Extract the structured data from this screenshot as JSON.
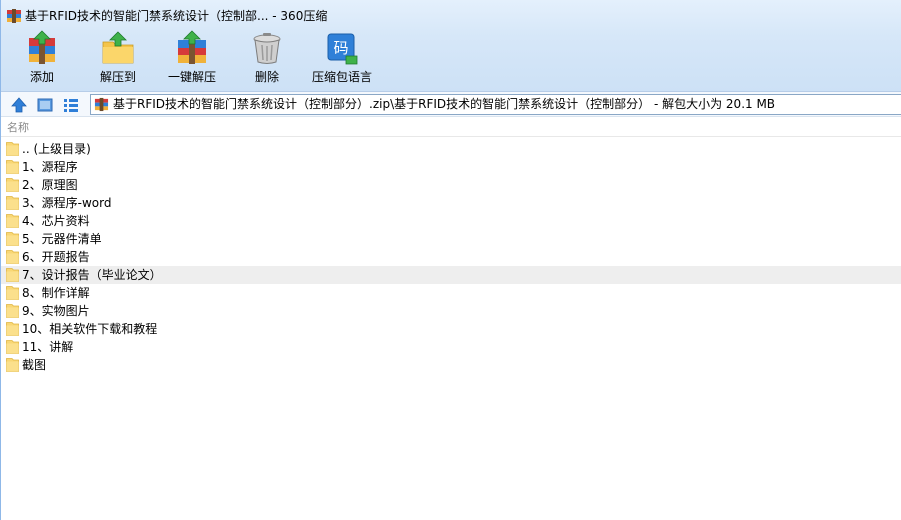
{
  "window": {
    "title": "基于RFID技术的智能门禁系统设计（控制部... - 360压缩"
  },
  "toolbar": {
    "buttons": [
      {
        "label": "添加",
        "icon": "add-archive-icon"
      },
      {
        "label": "解压到",
        "icon": "extract-to-icon"
      },
      {
        "label": "一键解压",
        "icon": "one-click-extract-icon"
      },
      {
        "label": "删除",
        "icon": "delete-trash-icon"
      },
      {
        "label": "压缩包语言",
        "icon": "archive-language-icon"
      }
    ]
  },
  "addressbar": {
    "path": "基于RFID技术的智能门禁系统设计（控制部分）.zip\\基于RFID技术的智能门禁系统设计（控制部分） - 解包大小为 20.1 MB"
  },
  "list": {
    "column_name": "名称",
    "items": [
      {
        "name": ".. (上级目录)"
      },
      {
        "name": "1、源程序"
      },
      {
        "name": "2、原理图"
      },
      {
        "name": "3、源程序-word"
      },
      {
        "name": "4、芯片资料"
      },
      {
        "name": "5、元器件清单"
      },
      {
        "name": "6、开题报告"
      },
      {
        "name": "7、设计报告（毕业论文）"
      },
      {
        "name": "8、制作详解"
      },
      {
        "name": "9、实物图片"
      },
      {
        "name": "10、相关软件下载和教程"
      },
      {
        "name": "11、讲解"
      },
      {
        "name": "截图"
      }
    ],
    "highlighted_index": 7
  },
  "colors": {
    "toolbar_bg": "#d6e7f8",
    "folder": "#f8d775",
    "row_highlight": "#eeeeee",
    "header_text": "#8a8a8a"
  }
}
